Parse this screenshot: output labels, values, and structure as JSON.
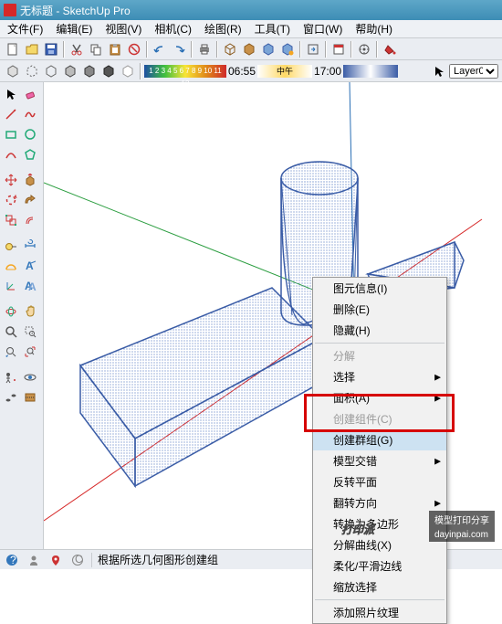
{
  "title": "无标题 - SketchUp Pro",
  "menu": {
    "file": "文件(F)",
    "edit": "编辑(E)",
    "view": "视图(V)",
    "camera": "相机(C)",
    "draw": "绘图(R)",
    "tools": "工具(T)",
    "window": "窗口(W)",
    "help": "帮助(H)"
  },
  "timescale": {
    "numbers": "1 2 3 4 5 6 7 8 9 10 11 12",
    "t1": "06:55",
    "tmid": "中午",
    "t2": "17:00"
  },
  "layer": {
    "label": "Layer0"
  },
  "ctx": {
    "entity_info": "图元信息(I)",
    "delete": "删除(E)",
    "hide": "隐藏(H)",
    "explode": "分解",
    "select": "选择",
    "area": "面积(A)",
    "make_component": "创建组件(C)",
    "make_group": "创建群组(G)",
    "intersect": "模型交错",
    "reverse_faces": "反转平面",
    "flip_along": "翻转方向",
    "convert_poly": "转换为多边形",
    "explode_curve": "分解曲线(X)",
    "soften": "柔化/平滑边线",
    "zoom_selection": "缩放选择",
    "add_photo": "添加照片纹理"
  },
  "status": {
    "hint": "根据所选几何图形创建组"
  },
  "watermark": {
    "logo": "打印派",
    "sub": "模型打印分享",
    "url": "dayinpai.com"
  }
}
